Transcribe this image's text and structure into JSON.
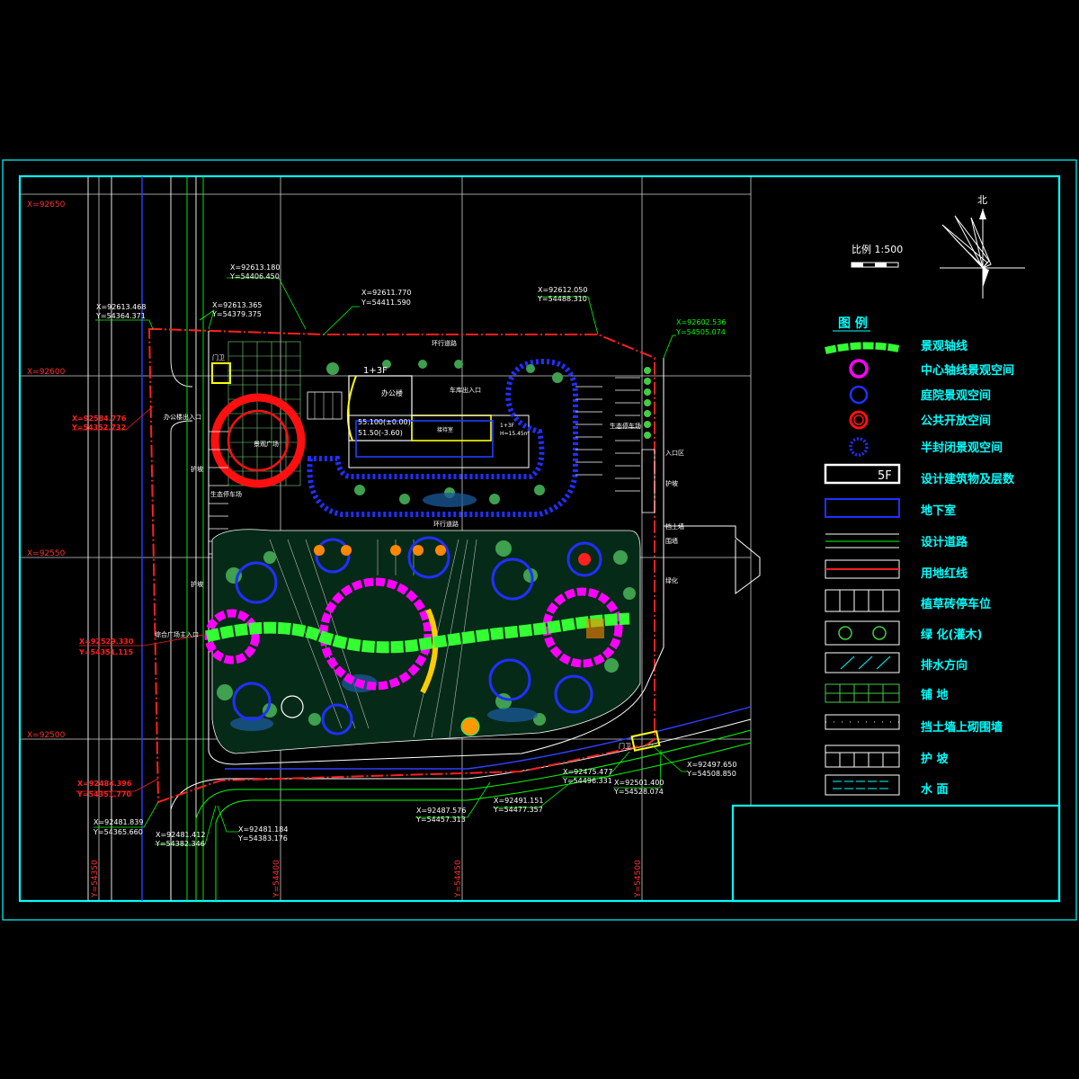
{
  "drawing": {
    "scale_label": "比例 1:500",
    "north_label": "北",
    "legend_title": "图 例",
    "colors": {
      "background": "#000000",
      "frame": "#00ffff",
      "red_line": "#ff2020",
      "green": "#00ff00",
      "magenta": "#ff00ff",
      "blue": "#1020ff",
      "yellow": "#ffff00",
      "grid": "#cfcfcf"
    }
  },
  "grid_labels": {
    "x_lines": [
      "X=92650",
      "X=92600",
      "X=92550",
      "X=92500"
    ],
    "y_lines": [
      "Y=54350",
      "Y=54400",
      "Y=54450",
      "Y=54500"
    ]
  },
  "coordinates": [
    {
      "x": "X=92613.468",
      "y": "Y=54364.371"
    },
    {
      "x": "X=92613.180",
      "y": "Y=54406.450"
    },
    {
      "x": "X=92613.365",
      "y": "Y=54379.375"
    },
    {
      "x": "X=92611.770",
      "y": "Y=54411.590"
    },
    {
      "x": "X=92612.050",
      "y": "Y=54488.310"
    },
    {
      "x": "X=92602.536",
      "y": "Y=54505.074"
    },
    {
      "x": "X=92481.839",
      "y": "Y=54365.660"
    },
    {
      "x": "X=92481.412",
      "y": "Y=54382.346"
    },
    {
      "x": "X=92481.184",
      "y": "Y=54383.176"
    },
    {
      "x": "X=92487.576",
      "y": "Y=54457.313"
    },
    {
      "x": "X=92491.151",
      "y": "Y=54477.357"
    },
    {
      "x": "X=92475.477",
      "y": "Y=54496.331"
    },
    {
      "x": "X=92501.400",
      "y": "Y=54528.074"
    },
    {
      "x": "X=92497.650",
      "y": "Y=54508.850"
    }
  ],
  "red_coordinates": [
    {
      "x": "X=92584.776",
      "y": "Y=54352.732"
    },
    {
      "x": "X=92529.330",
      "y": "Y=54351.115"
    },
    {
      "x": "X=92484.396",
      "y": "Y=54351.770"
    }
  ],
  "building": {
    "floors": "1+3F",
    "name": "办公楼",
    "elev1": "55.100(±0.00)",
    "elev2": "51.50(-3.60)",
    "inner": "接待室",
    "right_label1": "1+3F",
    "right_label2": "H=15.45m"
  },
  "site_labels": {
    "plaza": "景观广场",
    "gate_top": "门卫",
    "gate_bottom": "门卫",
    "entrance_left": "办公楼出入口",
    "parking": "生态停车场",
    "walkway_top": "环行道路",
    "walkway_mid": "环行道路",
    "entrance_mid": "车库出入口",
    "entrance_bottom": "综合广场主入口",
    "guard_left": "护坡",
    "guard_left2": "护坡",
    "ecology_parking": "生态停车场",
    "entrance_right": "入口区",
    "right1": "护坡",
    "right2": "挡土墙",
    "right3": "围墙",
    "right4": "绿化"
  },
  "legend": [
    {
      "key": "axis",
      "label": "景观轴线"
    },
    {
      "key": "center",
      "label": "中心轴线景观空间"
    },
    {
      "key": "courtyard",
      "label": "庭院景观空间"
    },
    {
      "key": "public",
      "label": "公共开放空间"
    },
    {
      "key": "semi",
      "label": "半封闭景观空间"
    },
    {
      "key": "building",
      "label": "设计建筑物及层数",
      "sample": "5F"
    },
    {
      "key": "basement",
      "label": "地下室"
    },
    {
      "key": "road",
      "label": "设计道路"
    },
    {
      "key": "redline",
      "label": "用地红线"
    },
    {
      "key": "parking",
      "label": "植草砖停车位"
    },
    {
      "key": "green",
      "label": "绿 化(灌木)"
    },
    {
      "key": "drain",
      "label": "排水方向"
    },
    {
      "key": "paving",
      "label": "铺    地"
    },
    {
      "key": "retaining",
      "label": "挡土墙上砌围墙"
    },
    {
      "key": "slope",
      "label": "护    坡"
    },
    {
      "key": "water",
      "label": "水    面"
    }
  ]
}
